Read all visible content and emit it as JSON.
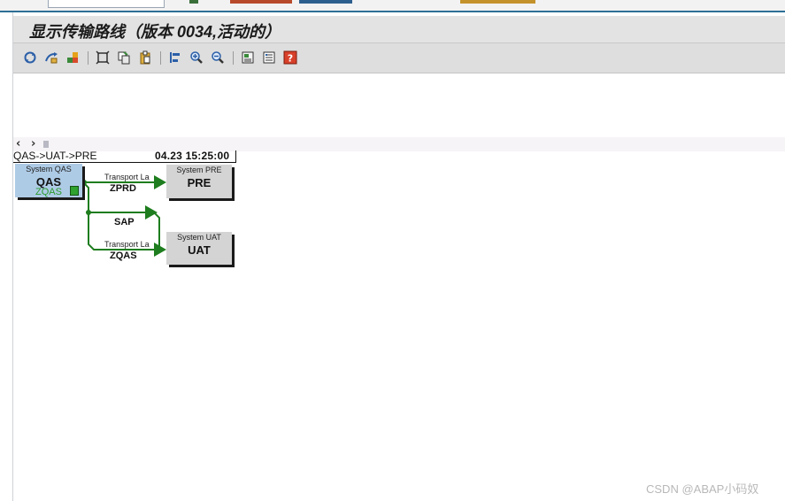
{
  "window": {
    "title": "显示传输路线（版本 0034,活动的）"
  },
  "toolbar": {
    "buttons": [
      {
        "name": "refresh-icon"
      },
      {
        "name": "display-change-icon"
      },
      {
        "name": "activate-icon"
      },
      {
        "name": "fit-screen-icon"
      },
      {
        "name": "copy-icon"
      },
      {
        "name": "paste-icon"
      },
      {
        "name": "align-left-icon"
      },
      {
        "name": "zoom-in-icon"
      },
      {
        "name": "zoom-out-icon"
      },
      {
        "name": "print-icon"
      },
      {
        "name": "list-icon"
      },
      {
        "name": "help-icon"
      }
    ]
  },
  "navigation": {
    "prev": "‹",
    "next": "›"
  },
  "route": {
    "name": "QAS->UAT->PRE",
    "timestamp": "04.23  15:25:00"
  },
  "systems": {
    "qas": {
      "caption": "System QAS",
      "sid": "QAS",
      "client": "ZQAS"
    },
    "pre": {
      "caption": "System PRE",
      "sid": "PRE"
    },
    "uat": {
      "caption": "System UAT",
      "sid": "UAT"
    }
  },
  "connections": {
    "to_pre": {
      "layer": "Transport La",
      "target": "ZPRD"
    },
    "sap": {
      "label": "SAP"
    },
    "to_uat": {
      "layer": "Transport La",
      "target": "ZQAS"
    }
  },
  "colors": {
    "connection": "#1e7d1e",
    "selected_system": "#aecbe6"
  },
  "watermark": "CSDN @ABAP小码奴"
}
